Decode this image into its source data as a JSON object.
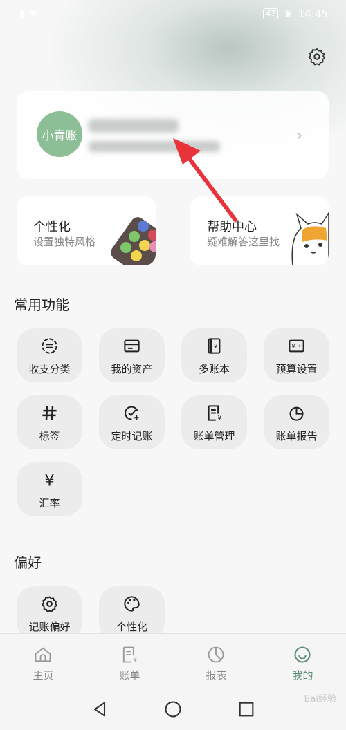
{
  "status_bar": {
    "time": "14:45",
    "battery": "47"
  },
  "profile": {
    "avatar_text": "小青账"
  },
  "features": [
    {
      "title": "个性化",
      "subtitle": "设置独特风格"
    },
    {
      "title": "帮助中心",
      "subtitle": "疑难解答这里找"
    }
  ],
  "sections": {
    "common": "常用功能",
    "preferences": "偏好"
  },
  "common_functions": [
    {
      "label": "收支分类",
      "icon": "category-icon"
    },
    {
      "label": "我的资产",
      "icon": "card-icon"
    },
    {
      "label": "多账本",
      "icon": "ledger-icon"
    },
    {
      "label": "预算设置",
      "icon": "budget-icon"
    },
    {
      "label": "标签",
      "icon": "hashtag-icon"
    },
    {
      "label": "定时记账",
      "icon": "scheduled-check-icon"
    },
    {
      "label": "账单管理",
      "icon": "bill-icon"
    },
    {
      "label": "账单报告",
      "icon": "pie-chart-icon"
    },
    {
      "label": "汇率",
      "icon": "yen-icon"
    }
  ],
  "preference_items": [
    {
      "label": "记账偏好",
      "icon": "gear-icon"
    },
    {
      "label": "个性化",
      "icon": "palette-icon"
    }
  ],
  "tabs": [
    {
      "label": "主页",
      "icon": "home-icon"
    },
    {
      "label": "账单",
      "icon": "bill-icon"
    },
    {
      "label": "报表",
      "icon": "chart-icon"
    },
    {
      "label": "我的",
      "icon": "smile-icon",
      "active": true
    }
  ],
  "colors": {
    "accent": "#5c8f76",
    "avatar": "#8cbf95",
    "arrow": "#e8333a"
  },
  "watermark": "Bai经验"
}
